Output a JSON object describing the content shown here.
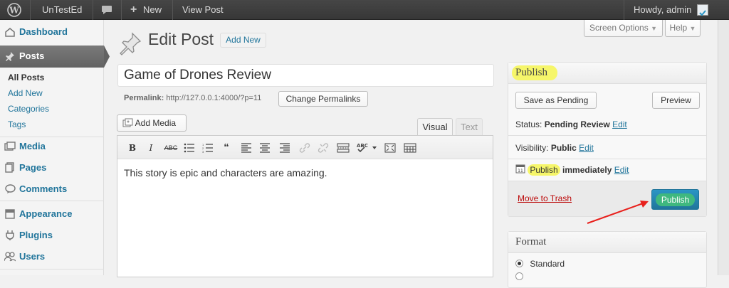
{
  "adminbar": {
    "site_name": "UnTestEd",
    "new_label": "New",
    "view_post_label": "View Post",
    "greeting": "Howdy, admin"
  },
  "sidebar": {
    "items": [
      {
        "label": "Dashboard",
        "icon": "dashboard-icon"
      },
      {
        "label": "Posts",
        "icon": "pin-icon"
      },
      {
        "label": "Media",
        "icon": "media-icon"
      },
      {
        "label": "Pages",
        "icon": "pages-icon"
      },
      {
        "label": "Comments",
        "icon": "comments-icon"
      },
      {
        "label": "Appearance",
        "icon": "appearance-icon"
      },
      {
        "label": "Plugins",
        "icon": "plugins-icon"
      },
      {
        "label": "Users",
        "icon": "users-icon"
      }
    ],
    "posts_submenu": [
      "All Posts",
      "Add New",
      "Categories",
      "Tags"
    ]
  },
  "header": {
    "title": "Edit Post",
    "add_new": "Add New",
    "screen_options": "Screen Options",
    "help": "Help"
  },
  "editor": {
    "post_title": "Game of Drones Review",
    "permalink_label": "Permalink:",
    "permalink_url": "http://127.0.0.1:4000/?p=11",
    "change_permalinks": "Change Permalinks",
    "add_media": "Add Media",
    "tab_visual": "Visual",
    "tab_text": "Text",
    "content": "This story is epic and characters are amazing."
  },
  "publish": {
    "title": "Publish",
    "save_pending": "Save as Pending",
    "preview": "Preview",
    "status_label": "Status:",
    "status_value": "Pending Review",
    "visibility_label": "Visibility:",
    "visibility_value": "Public",
    "publish_word": "Publish",
    "immediately": "immediately",
    "edit": "Edit",
    "move_trash": "Move to Trash",
    "publish_button": "Publish"
  },
  "format": {
    "title": "Format",
    "selected": "Standard"
  },
  "colors": {
    "link": "#21759b",
    "trash": "#bc0b0b",
    "highlight": "#f6f66a",
    "publish_btn": "#2a95c5",
    "annotation_arrow": "#e8201c"
  }
}
